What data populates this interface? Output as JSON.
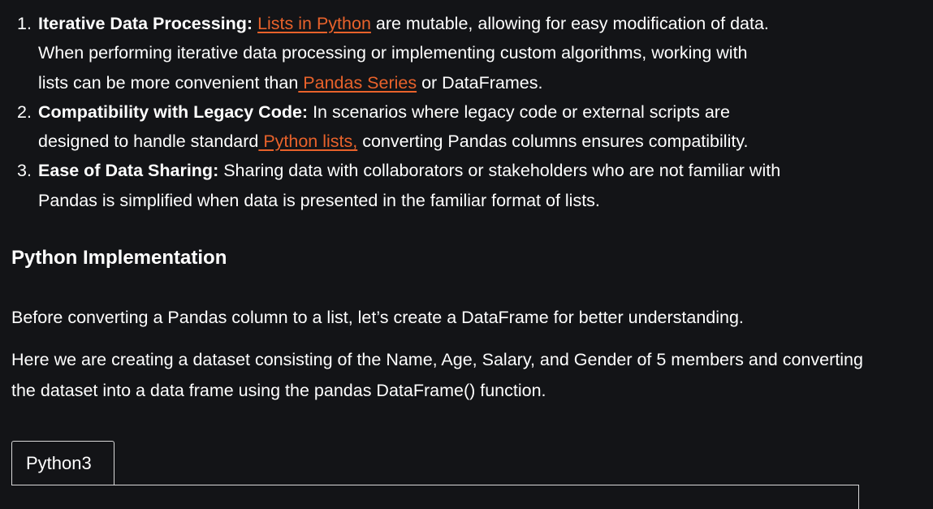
{
  "benefits": [
    {
      "number": "1.",
      "term": "Iterative Data Processing:",
      "link": "Lists in Python",
      "text_after_link": " are mutable, allowing for easy modification of data.",
      "line2": "When performing iterative data processing or implementing custom algorithms, working with",
      "line3_before": "lists can be more convenient than",
      "line3_link": " Pandas Series",
      "line3_after": " or DataFrames."
    },
    {
      "number": "2.",
      "term": "Compatibility with Legacy Code:",
      "text_after_term": " In scenarios where legacy code or external scripts are",
      "line2_before": "designed to handle standard",
      "line2_link": " Python lists,",
      "line2_after": " converting Pandas columns ensures compatibility."
    },
    {
      "number": "3.",
      "term": "Ease of Data Sharing:",
      "text_after_term": " Sharing data with collaborators or stakeholders who are not familiar with",
      "line2": "Pandas is simplified when data is presented in the familiar format of lists."
    }
  ],
  "section_heading": "Python Implementation",
  "paragraph1": "Before converting a Pandas column to a list, let’s create a DataFrame for better understanding.",
  "paragraph2": "Here we are creating a dataset consisting of the Name, Age, Salary, and Gender of 5 members and converting the dataset into a data frame using the pandas DataFrame() function.",
  "code_tab": {
    "label": "Python3"
  },
  "colors": {
    "background": "#131417",
    "text": "#ffffff",
    "link": "#e8622b",
    "border": "#d9d9d9"
  }
}
